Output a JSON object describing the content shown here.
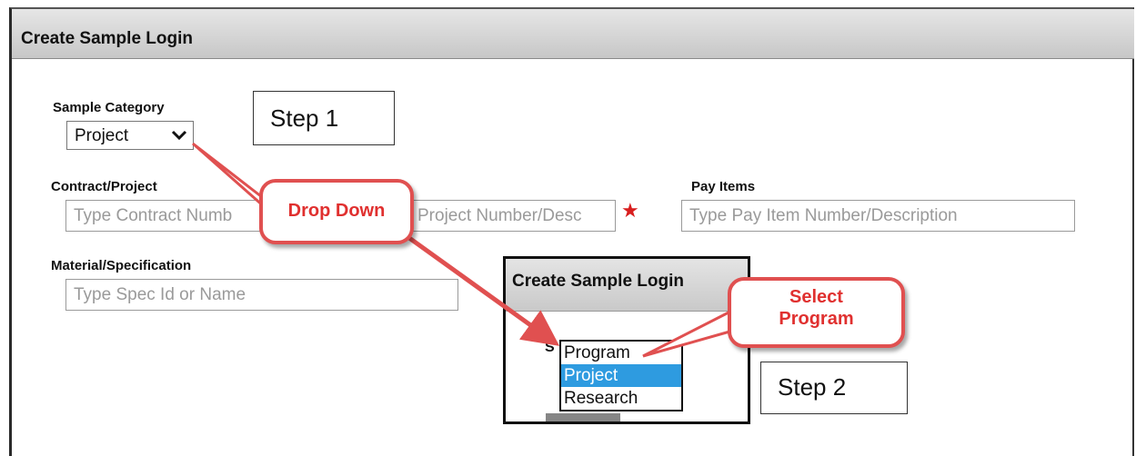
{
  "window": {
    "title": "Create Sample Login"
  },
  "form": {
    "sample_category_label": "Sample Category",
    "sample_category_value": "Project",
    "contract_project_label": "Contract/Project",
    "contract_placeholder": "Type Contract Numb",
    "project_placeholder": "Project Number/Desc",
    "pay_items_label": "Pay Items",
    "pay_items_placeholder": "Type Pay Item Number/Description",
    "material_label": "Material/Specification",
    "material_placeholder": "Type Spec Id or Name",
    "required_icon": "star-icon"
  },
  "annotations": {
    "step1": "Step 1",
    "step2": "Step 2",
    "callout_dropdown": "Drop Down",
    "callout_select": "Select Program"
  },
  "inset": {
    "title": "Create Sample Login",
    "options": [
      "Program",
      "Project",
      "Research"
    ],
    "selected": "Project"
  },
  "colors": {
    "callout": "#e05050",
    "highlight": "#2e9be0",
    "required": "#d81e1e"
  }
}
